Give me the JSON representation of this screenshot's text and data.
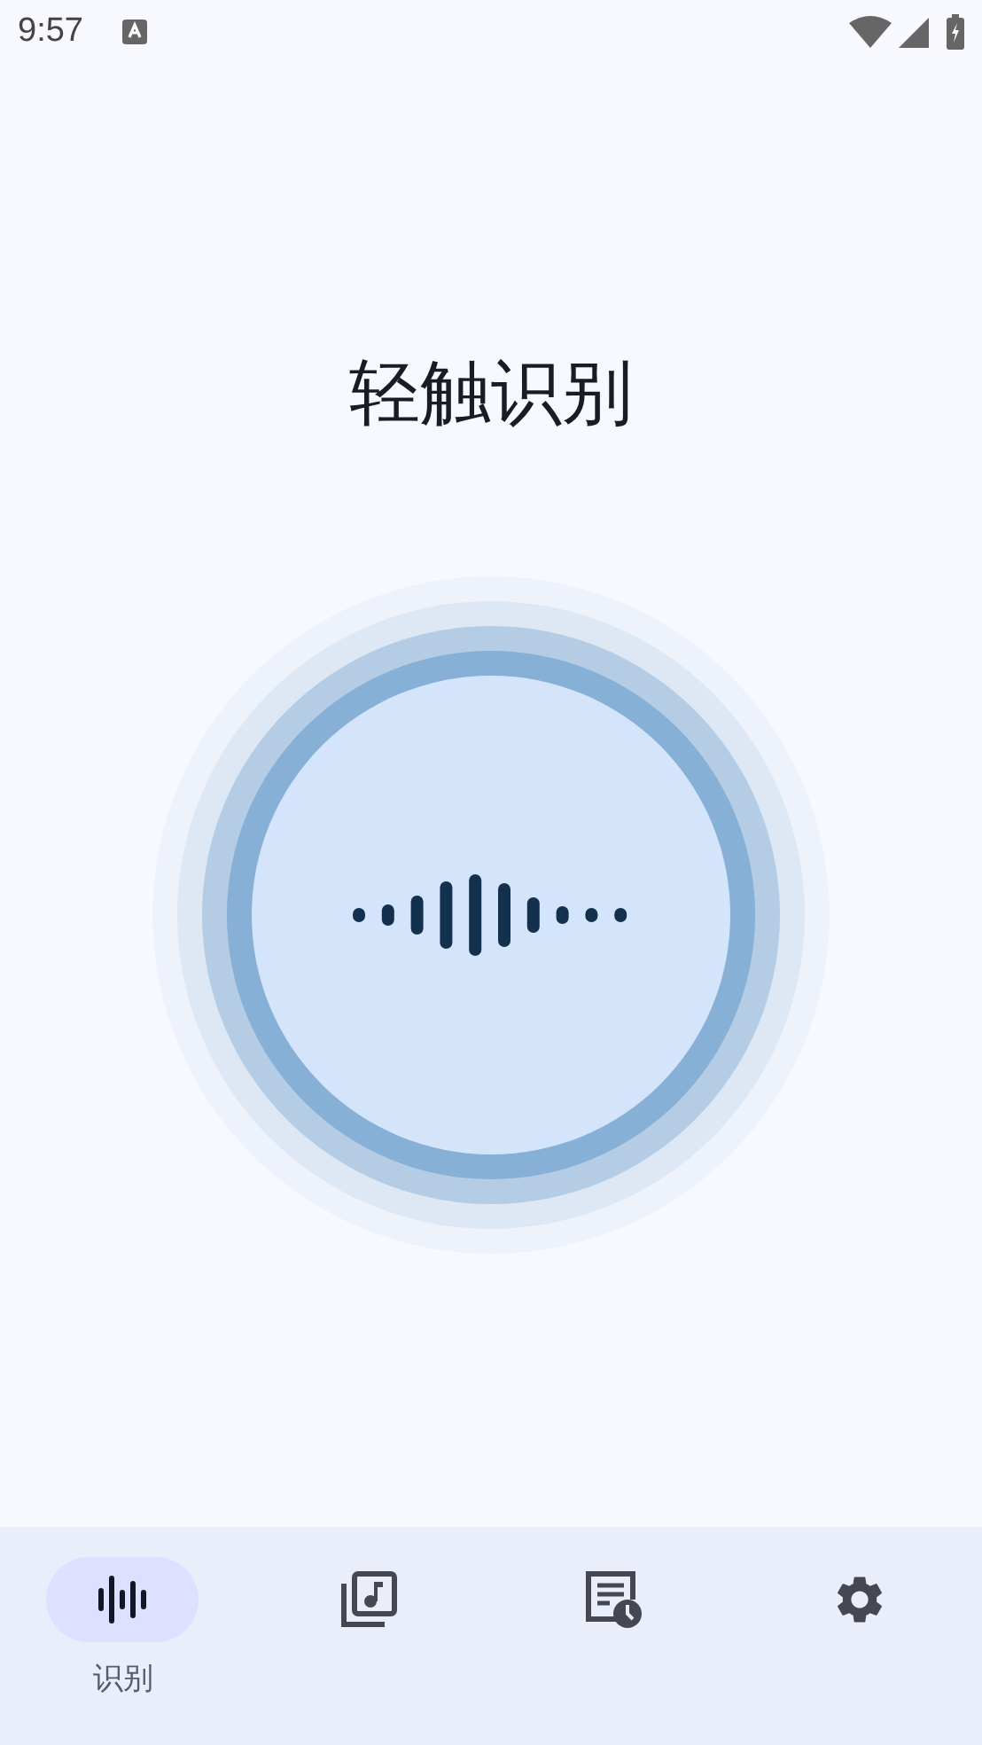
{
  "status_bar": {
    "time": "9:57"
  },
  "title": "轻触识别",
  "nav": [
    {
      "kind": "waveform",
      "selected": true,
      "label": "识别"
    },
    {
      "kind": "music-library",
      "selected": false
    },
    {
      "kind": "history",
      "selected": false
    },
    {
      "kind": "settings",
      "selected": false
    }
  ]
}
